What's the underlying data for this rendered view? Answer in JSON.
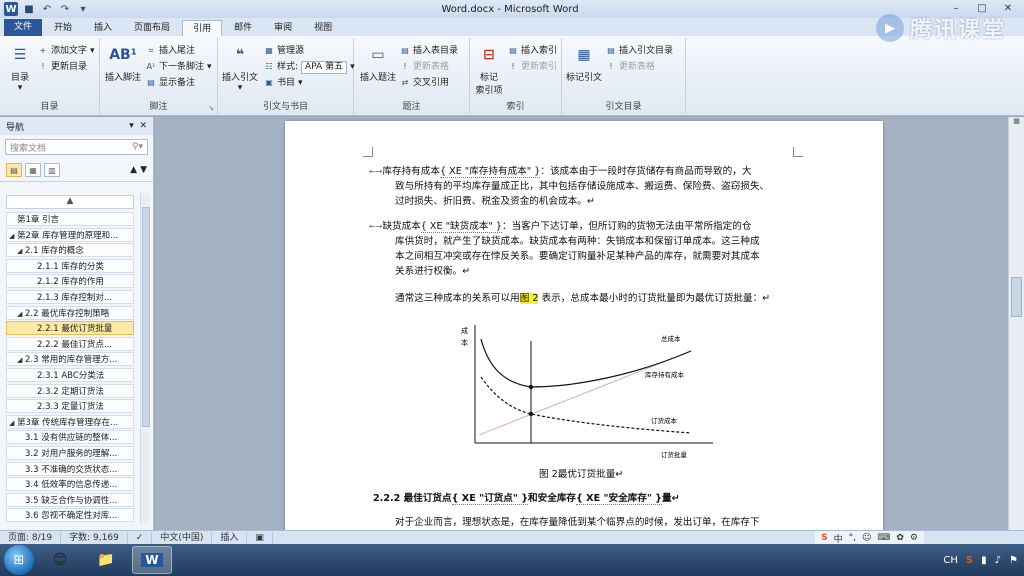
{
  "window": {
    "title": "Word.docx - Microsoft Word",
    "app_letter": "W"
  },
  "tabs": [
    "文件",
    "开始",
    "插入",
    "页面布局",
    "引用",
    "邮件",
    "审阅",
    "视图"
  ],
  "ribbon": {
    "toc": {
      "big": "目录",
      "add_text": "添加文字",
      "update_toc": "更新目录",
      "group": "目录"
    },
    "footnotes": {
      "big_label": "插入脚注",
      "big_icon": "AB¹",
      "insert_endnote": "插入尾注",
      "next_footnote": "下一条脚注",
      "show_notes": "显示备注",
      "group": "脚注"
    },
    "citations": {
      "big": "插入引文",
      "manage_sources": "管理源",
      "style_label": "样式:",
      "style_value": "APA 第五",
      "bibliography": "书目",
      "group": "引文与书目"
    },
    "captions": {
      "big": "插入题注",
      "insert_table_of_figures": "插入表目录",
      "update_table": "更新表格",
      "cross_reference": "交叉引用",
      "group": "题注"
    },
    "index": {
      "big_line1": "标记",
      "big_line2": "索引项",
      "insert_index": "插入索引",
      "update_index": "更新索引",
      "group": "索引"
    },
    "toa": {
      "big": "标记引文",
      "insert_toa": "插入引文目录",
      "update_table": "更新表格",
      "group": "引文目录"
    }
  },
  "watermark": "腾讯课堂",
  "nav": {
    "title": "导航",
    "search_placeholder": "搜索文档",
    "collapse_symbol": "▲",
    "headings": [
      {
        "text": "第1章 引言",
        "level": 1,
        "tri": ""
      },
      {
        "text": "第2章 库存管理的原理和...",
        "level": 1,
        "tri": "◢"
      },
      {
        "text": "2.1 库存的概念",
        "level": 2,
        "tri": "◢"
      },
      {
        "text": "2.1.1 库存的分类",
        "level": 3,
        "tri": ""
      },
      {
        "text": "2.1.2 库存的作用",
        "level": 3,
        "tri": ""
      },
      {
        "text": "2.1.3 库存控制对...",
        "level": 3,
        "tri": ""
      },
      {
        "text": "2.2 最优库存控制策略",
        "level": 2,
        "tri": "◢"
      },
      {
        "text": "2.2.1 最优订货批量",
        "level": 3,
        "tri": "",
        "selected": true
      },
      {
        "text": "2.2.2 最佳订货点...",
        "level": 3,
        "tri": ""
      },
      {
        "text": "2.3 常用的库存管理方...",
        "level": 2,
        "tri": "◢"
      },
      {
        "text": "2.3.1 ABC分类法",
        "level": 3,
        "tri": ""
      },
      {
        "text": "2.3.2 定期订货法",
        "level": 3,
        "tri": ""
      },
      {
        "text": "2.3.3 定量订货法",
        "level": 3,
        "tri": ""
      },
      {
        "text": "第3章 传统库存管理存在...",
        "level": 1,
        "tri": "◢"
      },
      {
        "text": "3.1 没有供应链的整体...",
        "level": 2,
        "tri": ""
      },
      {
        "text": "3.2 对用户服务的理解...",
        "level": 2,
        "tri": ""
      },
      {
        "text": "3.3 不准确的交货状态...",
        "level": 2,
        "tri": ""
      },
      {
        "text": "3.4 低效率的信息传递...",
        "level": 2,
        "tri": ""
      },
      {
        "text": "3.5 缺乏合作与协调性...",
        "level": 2,
        "tri": ""
      },
      {
        "text": "3.6 忽视不确定性对库...",
        "level": 2,
        "tri": ""
      }
    ]
  },
  "doc": {
    "p1_a": "库存持有成本",
    "p1_field": "{ XE \"库存持有成本\" }",
    "p1_b": "：该成本由于一段时存货储存有商品而导致的，大",
    "p1_l2": "致与所持有的平均库存量成正比，其中包括存储设施成本、搬运费、保险费、盗窃损失、",
    "p1_l3": "过时损失、折旧费、税金及资金的机会成本。↵",
    "p2_a": "缺货成本",
    "p2_field": "{ XE \"缺货成本\" }",
    "p2_b": "：当客户下达订单，但所订购的货物无法由平常所指定的仓",
    "p2_l2": "库供货时，就产生了缺货成本。缺货成本有两种：失销成本和保留订单成本。这三种成",
    "p2_l3": "本之间相互冲突或存在悖反关系。要确定订购量补足某种产品的库存，就需要对其成本",
    "p2_l4": "关系进行权衡。↵",
    "p3_a": "通常这三种成本的关系可以用",
    "p3_hl": "图 2",
    "p3_b": " 表示，总成本最小时的订货批量即为最优订货批量：↵",
    "caption": "图 2最优订货批量↵",
    "h222_a": "2.2.2 最佳订货点",
    "h222_f1": "{ XE \"订货点\" }",
    "h222_b": "和安全库存",
    "h222_f2": "{ XE \"安全库存\" }",
    "h222_c": "量↵",
    "p4": "对于企业而言，理想状态是，在库存量降低到某个临界点的时候，发出订单，在库存下",
    "bullet": "←→"
  },
  "chart_data": {
    "type": "line",
    "title": "",
    "ylabel": "成本",
    "xlabel": "订货批量",
    "series": [
      {
        "name": "总成本",
        "style": "solid",
        "shape": "U-curve with minimum at the vertical line"
      },
      {
        "name": "库存持有成本",
        "style": "solid-light",
        "shape": "increasing straight line"
      },
      {
        "name": "订货成本",
        "style": "dashed",
        "shape": "decreasing hyperbola"
      }
    ],
    "annotations": [
      "vertical line at optimal order quantity",
      "minimum points marked with dots"
    ]
  },
  "status": {
    "page": "页面: 8/19",
    "words": "字数: 9,169",
    "lang": "中文(中国)",
    "mode": "插入",
    "ime_lang": "中",
    "tray_lang": "CH"
  },
  "colors": {
    "file_tab": "#2b579a",
    "highlight": "#f9ef2a",
    "selected_heading": "#fde9a3"
  }
}
